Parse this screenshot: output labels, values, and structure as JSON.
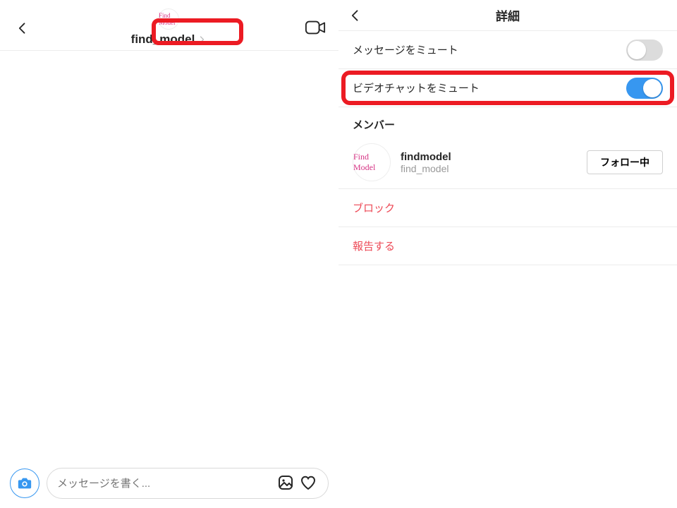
{
  "left": {
    "avatar_text": "Find Model",
    "title": "find_model",
    "composer_placeholder": "メッセージを書く..."
  },
  "right": {
    "title": "詳細",
    "mute_messages_label": "メッセージをミュート",
    "mute_video_label": "ビデオチャットをミュート",
    "mute_messages_on": false,
    "mute_video_on": true,
    "members_label": "メンバー",
    "member": {
      "avatar_text": "Find Model",
      "display_name": "findmodel",
      "username": "find_model",
      "follow_button": "フォロー中"
    },
    "block_label": "ブロック",
    "report_label": "報告する"
  },
  "colors": {
    "highlight": "#ec1b23",
    "accent": "#3797f0",
    "danger": "#ed4956"
  }
}
